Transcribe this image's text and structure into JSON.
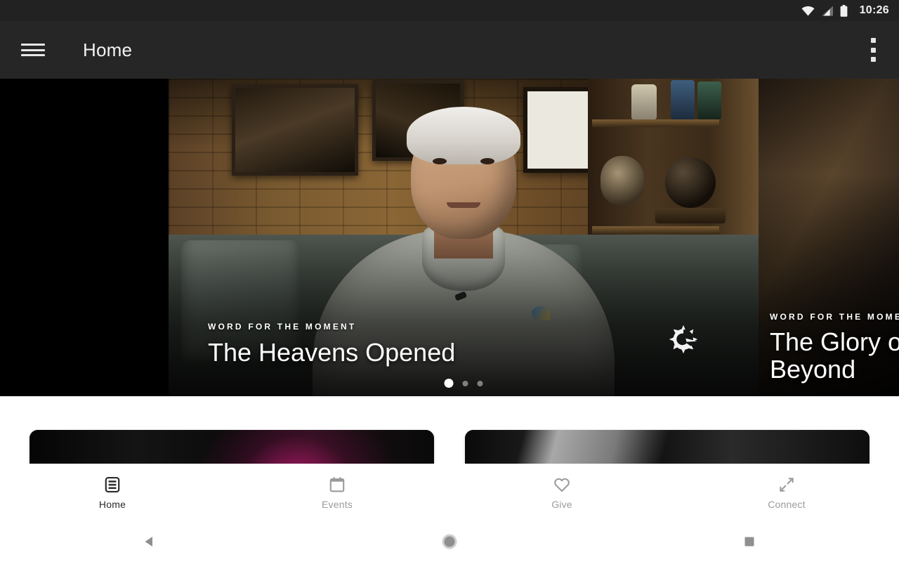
{
  "status_bar": {
    "time": "10:26",
    "icons": [
      "wifi-icon",
      "cellular-signal-icon",
      "battery-icon"
    ]
  },
  "app_bar": {
    "menu_icon": "hamburger-menu-icon",
    "title": "Home",
    "overflow_icon": "more-vert-icon"
  },
  "hero": {
    "active_slide": {
      "kicker": "WORD FOR THE MOMENT",
      "title": "The Heavens Opened",
      "logo": "sunburst-logo"
    },
    "next_slide": {
      "kicker": "WORD FOR THE MOMENT",
      "title": "The Glory o\nBeyond"
    },
    "pagination": {
      "total": 3,
      "active_index": 0
    }
  },
  "content": {
    "cards": [
      {
        "name": "card-left",
        "accent": "#ec1e8c"
      },
      {
        "name": "card-right",
        "accent": "#d7d7d7"
      }
    ]
  },
  "bottom_nav": {
    "items": [
      {
        "label": "Home",
        "icon": "article-icon",
        "active": true
      },
      {
        "label": "Events",
        "icon": "calendar-icon",
        "active": false
      },
      {
        "label": "Give",
        "icon": "heart-icon",
        "active": false
      },
      {
        "label": "Connect",
        "icon": "arrows-icon",
        "active": false
      }
    ]
  },
  "system_nav": {
    "back": "back-triangle-icon",
    "home": "home-circle-icon",
    "recents": "recents-square-icon"
  },
  "colors": {
    "status_bar_bg": "#222222",
    "app_bar_bg": "#262626",
    "content_bg": "#ffffff",
    "nav_active": "#2b2b2b",
    "nav_inactive": "#9b9b9b"
  }
}
